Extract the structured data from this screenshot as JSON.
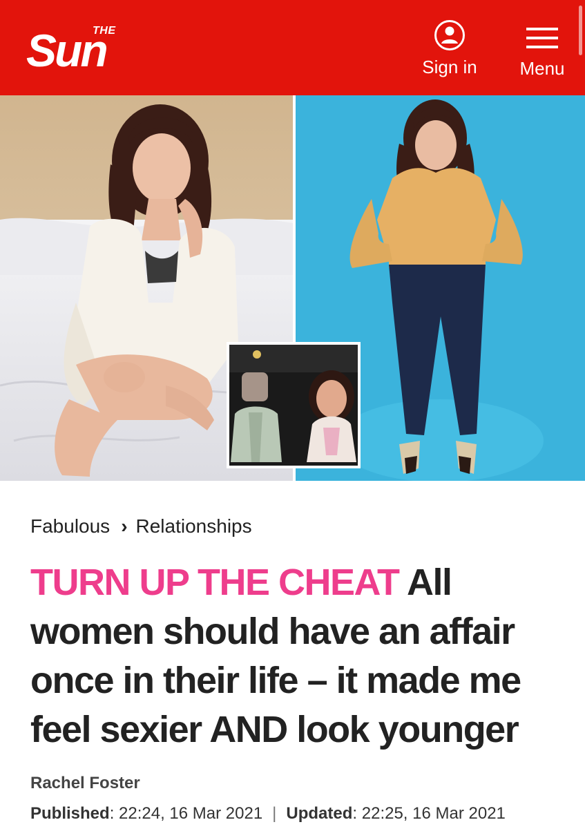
{
  "brand": {
    "logo_top": "THE",
    "logo_main": "Sun",
    "bar_color": "#e2140c"
  },
  "header": {
    "signin_label": "Sign in",
    "signin_icon": "user-circle-icon",
    "menu_label": "Menu",
    "menu_icon": "hamburger-icon"
  },
  "breadcrumb": {
    "section": "Fabulous",
    "subsection": "Relationships"
  },
  "headline": {
    "kicker": "TURN UP THE CHEAT",
    "kicker_color": "#ee3d8c",
    "text": "All women should have an affair once in their life – it made me feel sexier AND look younger"
  },
  "article": {
    "author": "Rachel Foster",
    "published_label": "Published",
    "published_value": ": 22:24, 16 Mar 2021",
    "separator": "|",
    "updated_label": "Updated",
    "updated_value": ": 22:25, 16 Mar 2021"
  }
}
